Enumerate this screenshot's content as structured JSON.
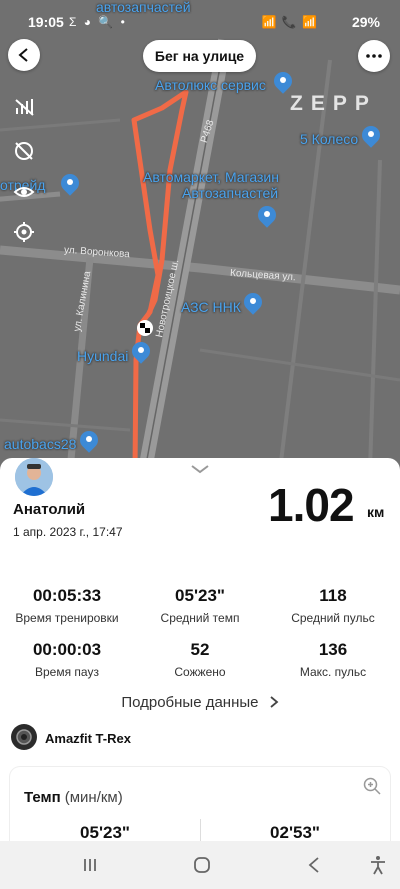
{
  "status": {
    "time": "19:05",
    "left_icons": "Σ ◕ 🔍 •",
    "network_icons": "📶 📞 📶",
    "battery": "29%"
  },
  "header": {
    "title": "Бег на улице",
    "brand": "ZEPP"
  },
  "map": {
    "places": [
      {
        "name": "автозапчастей"
      },
      {
        "name": "Автолюкс сервис"
      },
      {
        "name": "5 Колесо"
      },
      {
        "name": "Автомаркет, Магазин"
      },
      {
        "name": "Автозапчастей"
      },
      {
        "name": "отрейд"
      },
      {
        "name": "АЗС ННК"
      },
      {
        "name": "Hyundai"
      },
      {
        "name": "autobacs28"
      }
    ],
    "streets": [
      {
        "name": "Р468"
      },
      {
        "name": "ул. Воронкова"
      },
      {
        "name": "Кольцевая ул."
      },
      {
        "name": "ул. Калинина"
      },
      {
        "name": "Новотроицкое ш."
      }
    ],
    "route_color": "#f06a47"
  },
  "summary": {
    "user_name": "Анатолий",
    "datetime": "1 апр. 2023 г., 17:47",
    "distance": "1.02",
    "distance_unit": "км"
  },
  "stats": [
    {
      "value": "00:05:33",
      "label": "Время тренировки"
    },
    {
      "value": "05'23\"",
      "label": "Средний темп"
    },
    {
      "value": "118",
      "label": "Средний пульс"
    },
    {
      "value": "00:00:03",
      "label": "Время пауз"
    },
    {
      "value": "52",
      "label": "Сожжено"
    },
    {
      "value": "136",
      "label": "Макс. пульс"
    }
  ],
  "details_label": "Подробные данные",
  "device": {
    "name": "Amazfit T-Rex"
  },
  "pace": {
    "title": "Темп",
    "unit": "(мин/км)",
    "avg": "05'23\"",
    "best": "02'53\""
  },
  "colors": {
    "map_bg": "#707070",
    "place_label": "#4aa3ee",
    "accent": "#f06a47"
  }
}
